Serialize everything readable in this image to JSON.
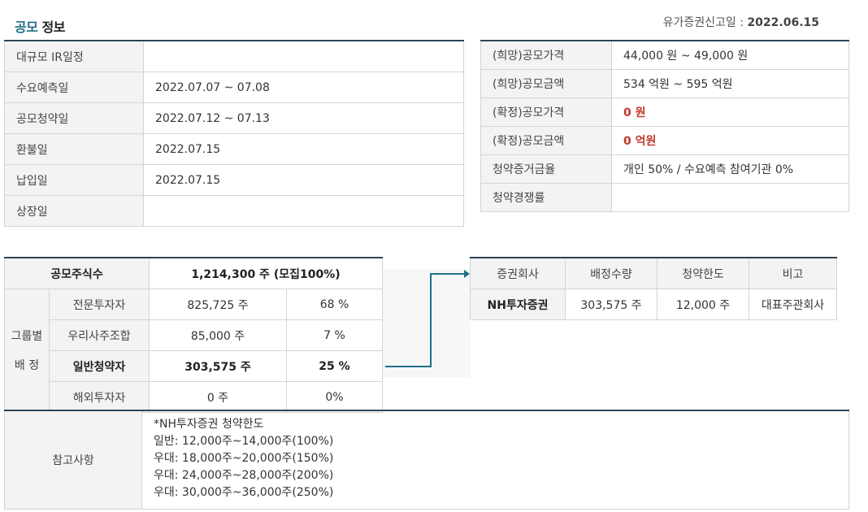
{
  "header": {
    "title_part1": "공모",
    "title_part2": "정보",
    "filing_label": "유가증권신고일 : ",
    "filing_date": "2022.06.15"
  },
  "schedule": [
    {
      "label": "대규모 IR일정",
      "value": ""
    },
    {
      "label": "수요예측일",
      "value": "2022.07.07 ~ 07.08"
    },
    {
      "label": "공모청약일",
      "value": "2022.07.12 ~ 07.13"
    },
    {
      "label": "환불일",
      "value": "2022.07.15"
    },
    {
      "label": "납입일",
      "value": "2022.07.15"
    },
    {
      "label": "상장일",
      "value": ""
    }
  ],
  "price_info": [
    {
      "label": "(희망)공모가격",
      "value": "44,000 원 ~ 49,000 원"
    },
    {
      "label": "(희망)공모금액",
      "value": "534 억원  ~ 595 억원"
    },
    {
      "label": "(확정)공모가격",
      "value": "0 원"
    },
    {
      "label": "(확정)공모금액",
      "value": "0 억원"
    },
    {
      "label": "청약증거금율",
      "value": "개인 50% / 수요예측 참여기관 0%"
    },
    {
      "label": "청약경쟁률",
      "value": ""
    }
  ],
  "allocation": {
    "total_label": "공모주식수",
    "total_value": "1,214,300 주 (모집100%)",
    "group_label_1": "그룹별",
    "group_label_2": "배 정",
    "rows": [
      {
        "name": "전문투자자",
        "shares": "825,725 주",
        "pct": "68 %"
      },
      {
        "name": "우리사주조합",
        "shares": "85,000 주",
        "pct": "7 %"
      },
      {
        "name": "일반청약자",
        "shares": "303,575 주",
        "pct": "25 %"
      },
      {
        "name": "해외투자자",
        "shares": "0 주",
        "pct": "0%"
      }
    ]
  },
  "broker": {
    "headers": [
      "증권회사",
      "배정수량",
      "청약한도",
      "비고"
    ],
    "row": {
      "company": "NH투자증권",
      "qty": "303,575 주",
      "limit": "12,000 주",
      "note": "대표주관회사"
    }
  },
  "notes": {
    "label": "참고사항",
    "lines": [
      "*NH투자증권 청약한도",
      "일반: 12,000주~14,000주(100%)",
      "우대: 18,000주~20,000주(150%)",
      "우대: 24,000주~28,000주(200%)",
      "우대: 30,000주~36,000주(250%)"
    ]
  },
  "colors": {
    "accent": "#1f6f8b",
    "header_border": "#2b4559",
    "highlight_red": "#c0392b"
  }
}
